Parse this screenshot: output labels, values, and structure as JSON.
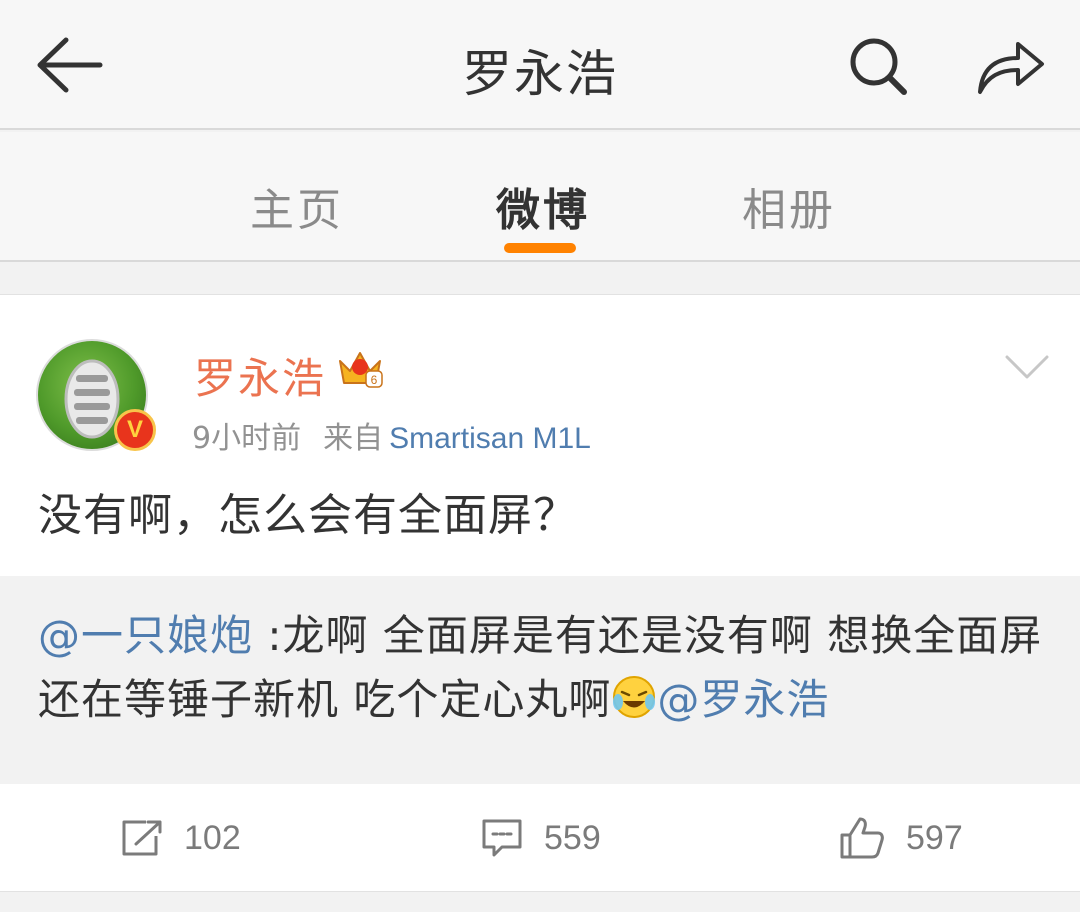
{
  "navbar": {
    "title": "罗永浩",
    "icons": [
      "back-arrow-icon",
      "search-icon",
      "share-icon"
    ]
  },
  "tabs": [
    {
      "label": "主页",
      "active": false
    },
    {
      "label": "微博",
      "active": true
    },
    {
      "label": "相册",
      "active": false
    }
  ],
  "post": {
    "author": "罗永浩",
    "author_level_badge": "6",
    "verified_mark": "V",
    "time": "9小时前",
    "source_label": "来自",
    "source_device": "Smartisan M1L",
    "text": "没有啊，怎么会有全面屏？",
    "quote": {
      "mention_author": "@一只娘炮",
      "text": " :龙啊 全面屏是有还是没有啊 想换全面屏 还在等锤子新机 吃个定心丸啊",
      "emoji": "laughing-crying-emoji",
      "mention_end": "@罗永浩"
    },
    "actions": {
      "repost_count": "102",
      "comment_count": "559",
      "like_count": "597"
    }
  },
  "colors": {
    "accent_orange": "#ff8200",
    "username_orange": "#eb7350",
    "link_blue": "#507daf",
    "muted_gray": "#929292"
  }
}
